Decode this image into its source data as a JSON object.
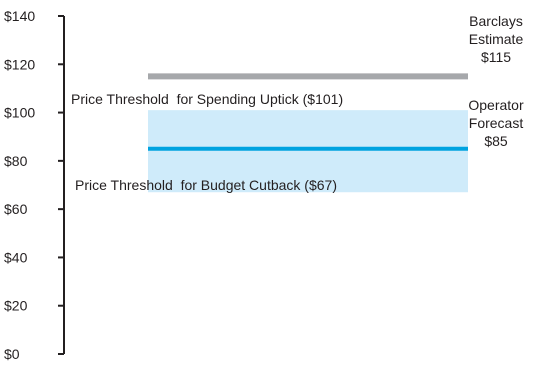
{
  "chart_data": {
    "type": "range",
    "title": "",
    "xlabel": "",
    "ylabel": "",
    "ylim": [
      0,
      140
    ],
    "y_ticks": [
      0,
      20,
      40,
      60,
      80,
      100,
      120,
      140
    ],
    "y_tick_labels": [
      "$0",
      "$20",
      "$40",
      "$60",
      "$80",
      "$100",
      "$120",
      "$140"
    ],
    "grid": false,
    "band": {
      "low": 67,
      "high": 101,
      "color": "#cfebfa"
    },
    "lines": [
      {
        "value": 115,
        "color": "#a6a8ab",
        "label_lines": [
          "Barclays",
          "Estimate",
          "$115"
        ]
      },
      {
        "value": 85,
        "color": "#00a3e0",
        "label_lines": [
          "Operator",
          "Forecast",
          "$85"
        ]
      }
    ],
    "thresholds": [
      {
        "value": 101,
        "label": "Price Threshold  for Spending Uptick ($101)"
      },
      {
        "value": 67,
        "label": "Price Threshold  for Budget Cutback ($67)"
      }
    ]
  }
}
